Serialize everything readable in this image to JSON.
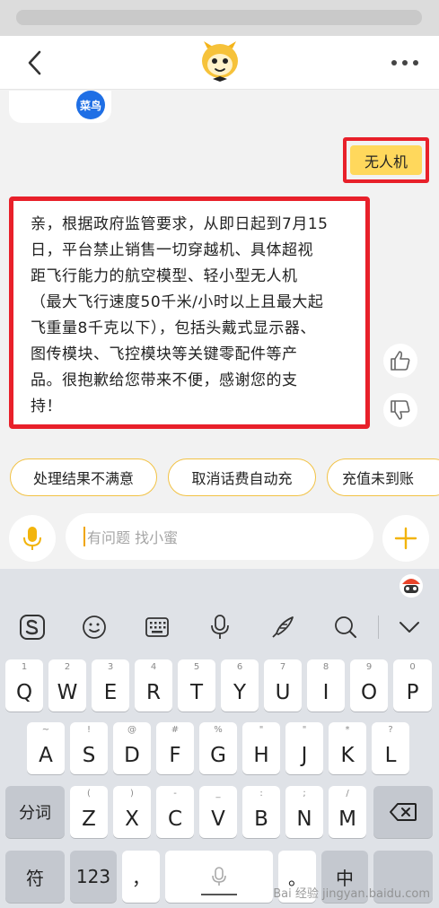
{
  "navbar": {
    "back_icon": "chevron-left-icon",
    "mascot_icon": "yellow-mascot-avatar",
    "more_icon": "more-dots-icon"
  },
  "chat": {
    "previous_card_badge": "菜鸟",
    "user_message": "无人机",
    "bot_message": "亲，根据政府监管要求，从即日起到7月15日，平台禁止销售一切穿越机、具体超视距飞行能力的航空模型、轻小型无人机（最大飞行速度50千米/小时以上且最大起飞重量8千克以下），包括头戴式显示器、图传模块、飞控模块等关键零配件等产品。很抱歉给您带来不便，感谢您的支持！",
    "bot_lines": [
      "亲，根据政府监管要求，从即日起到7月15",
      "日，平台禁止销售一切穿越机、具体超视",
      "距飞行能力的航空模型、轻小型无人机",
      "（最大飞行速度50千米/小时以上且最大起",
      "飞重量8千克以下），包括头戴式显示器、",
      "图传模块、飞控模块等关键零配件等产",
      "品。很抱歉给您带来不便，感谢您的支",
      "持！"
    ],
    "like_icon": "thumbs-up-icon",
    "dislike_icon": "thumbs-down-icon",
    "highlight_color": "#e8202a"
  },
  "quick_replies": [
    "处理结果不满意",
    "取消话费自动充",
    "充值未到账"
  ],
  "input": {
    "placeholder": "有问题 找小蜜",
    "mic_icon": "microphone-icon",
    "plus_icon": "plus-icon",
    "accent": "#f2b40c"
  },
  "keyboard": {
    "toolbar_icons": [
      "sogou-logo-icon",
      "emoji-icon",
      "keyboard-layout-icon",
      "voice-icon",
      "handwriting-icon",
      "search-icon",
      "collapse-chevron-icon"
    ],
    "row1": [
      {
        "main": "Q",
        "sub": "1"
      },
      {
        "main": "W",
        "sub": "2"
      },
      {
        "main": "E",
        "sub": "3"
      },
      {
        "main": "R",
        "sub": "4"
      },
      {
        "main": "T",
        "sub": "5"
      },
      {
        "main": "Y",
        "sub": "6"
      },
      {
        "main": "U",
        "sub": "7"
      },
      {
        "main": "I",
        "sub": "8"
      },
      {
        "main": "O",
        "sub": "9"
      },
      {
        "main": "P",
        "sub": "0"
      }
    ],
    "row2": [
      {
        "main": "A",
        "sub": "~"
      },
      {
        "main": "S",
        "sub": "!"
      },
      {
        "main": "D",
        "sub": "@"
      },
      {
        "main": "F",
        "sub": "#"
      },
      {
        "main": "G",
        "sub": "%"
      },
      {
        "main": "H",
        "sub": "\""
      },
      {
        "main": "J",
        "sub": "\""
      },
      {
        "main": "K",
        "sub": "*"
      },
      {
        "main": "L",
        "sub": "?"
      }
    ],
    "row3": [
      {
        "main": "Z",
        "sub": "("
      },
      {
        "main": "X",
        "sub": ")"
      },
      {
        "main": "C",
        "sub": "-"
      },
      {
        "main": "V",
        "sub": "_"
      },
      {
        "main": "B",
        "sub": ":"
      },
      {
        "main": "N",
        "sub": ";"
      },
      {
        "main": "M",
        "sub": "/"
      }
    ],
    "fenci": "分词",
    "delete_icon": "backspace-icon",
    "fu": "符",
    "num": "123",
    "comma": "，",
    "space_mic_icon": "microphone-icon",
    "period": "。",
    "zh": "中",
    "watermark": "Bai 经验 jingyan.baidu.com"
  }
}
